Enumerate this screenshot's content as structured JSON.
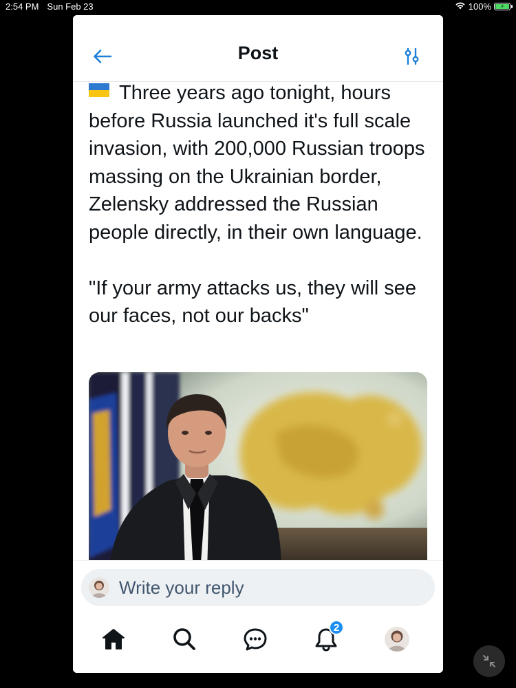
{
  "status_bar": {
    "time": "2:54 PM",
    "date": "Sun Feb 23",
    "battery": "100%",
    "battery_level": 1.0,
    "icons": [
      "wifi-icon",
      "battery-charging-icon"
    ]
  },
  "header": {
    "title": "Post",
    "back_icon": "arrow-left-icon",
    "settings_icon": "sliders-icon"
  },
  "post": {
    "flag_icon": "ukraine-flag-icon",
    "text": "Three years ago tonight, hours before Russia launched it's full scale invasion, with 200,000 Russian troops massing on the Ukrainian border, Zelensky addressed the Russian people directly, in their own language.\n\n\"If your army attacks us, they will see our faces, not our backs\""
  },
  "reply": {
    "placeholder": "Write your reply"
  },
  "tabbar": {
    "items": [
      {
        "name": "home",
        "icon": "home-icon"
      },
      {
        "name": "search",
        "icon": "search-icon"
      },
      {
        "name": "chat",
        "icon": "chat-icon"
      },
      {
        "name": "notifications",
        "icon": "bell-icon",
        "badge": "2"
      },
      {
        "name": "profile",
        "icon": "avatar"
      }
    ]
  },
  "colors": {
    "accent": "#1d8ff2",
    "text": "#0f1419",
    "placeholder": "#41566e",
    "battery": "#4cd964"
  }
}
